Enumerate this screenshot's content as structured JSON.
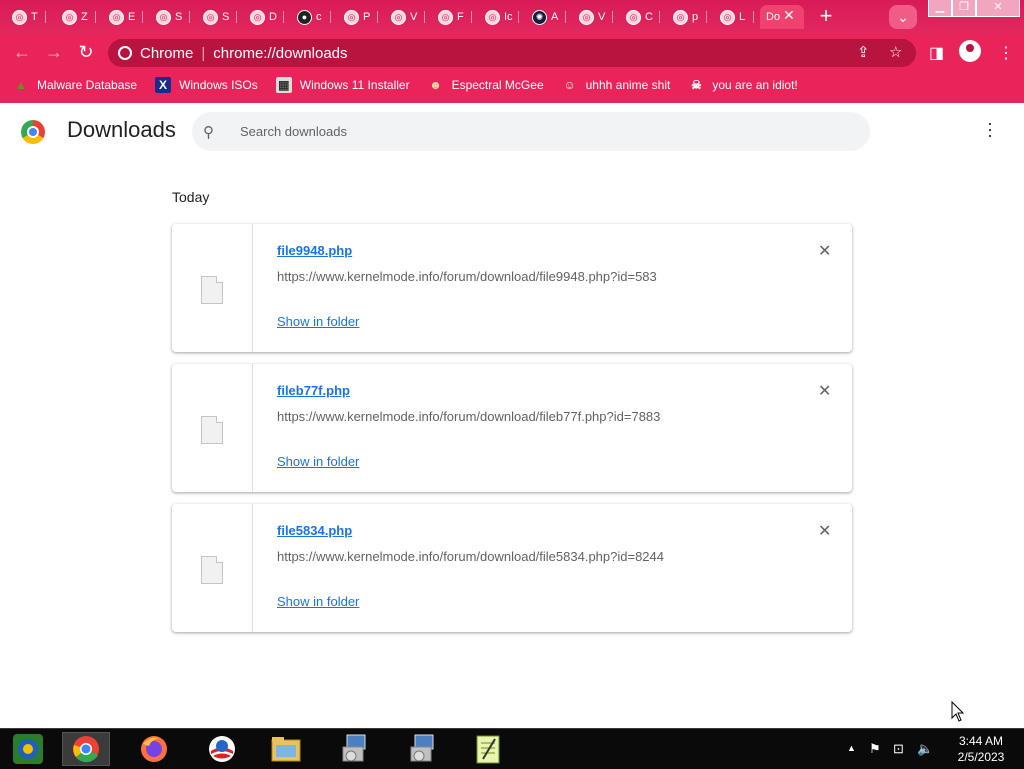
{
  "browser": {
    "tabs": [
      {
        "label": "T"
      },
      {
        "label": "Z"
      },
      {
        "label": "E"
      },
      {
        "label": "S"
      },
      {
        "label": "S"
      },
      {
        "label": "D"
      },
      {
        "label": "c"
      },
      {
        "label": "P"
      },
      {
        "label": "V"
      },
      {
        "label": "F"
      },
      {
        "label": "Ic"
      },
      {
        "label": "A"
      },
      {
        "label": "V"
      },
      {
        "label": "C"
      },
      {
        "label": "p"
      },
      {
        "label": "L"
      },
      {
        "label": "Do"
      }
    ],
    "site_label": "Chrome",
    "url": "chrome://downloads",
    "bookmarks": [
      {
        "label": "Malware Database"
      },
      {
        "label": "Windows ISOs"
      },
      {
        "label": "Windows 11 Installer"
      },
      {
        "label": "Espectral McGee"
      },
      {
        "label": "uhhh anime shit"
      },
      {
        "label": "you are an idiot!"
      }
    ]
  },
  "page": {
    "title": "Downloads",
    "search_placeholder": "Search downloads",
    "section": "Today",
    "downloads": [
      {
        "name": "file9948.php",
        "url": "https://www.kernelmode.info/forum/download/file9948.php?id=583",
        "action": "Show in folder"
      },
      {
        "name": "fileb77f.php",
        "url": "https://www.kernelmode.info/forum/download/fileb77f.php?id=7883",
        "action": "Show in folder"
      },
      {
        "name": "file5834.php",
        "url": "https://www.kernelmode.info/forum/download/file5834.php?id=8244",
        "action": "Show in folder"
      }
    ]
  },
  "taskbar": {
    "time": "3:44 AM",
    "date": "2/5/2023"
  },
  "colors": {
    "theme": "#e8245a",
    "link": "#1a73e8"
  }
}
